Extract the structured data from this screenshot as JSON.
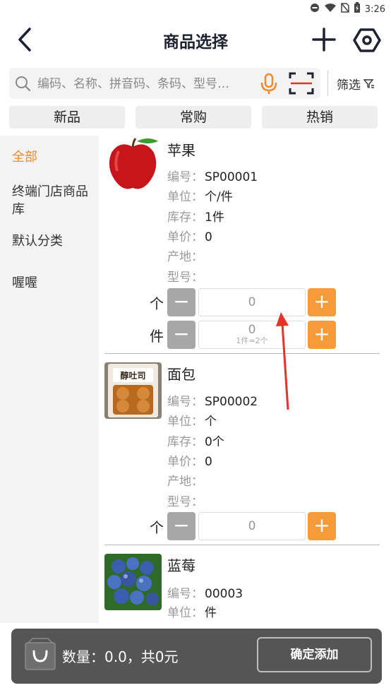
{
  "status_bar": {
    "time": "3:26"
  },
  "header": {
    "title": "商品选择"
  },
  "search": {
    "placeholder": "编码、名称、拼音码、条码、型号…",
    "filter_label": "筛选"
  },
  "tabs": [
    {
      "label": "新品"
    },
    {
      "label": "常购"
    },
    {
      "label": "热销"
    }
  ],
  "sidebar": {
    "items": [
      {
        "label": "全部",
        "active": true
      },
      {
        "label": "终端门店商品库"
      },
      {
        "label": "默认分类"
      },
      {
        "label": "喔喔"
      }
    ]
  },
  "products": [
    {
      "name": "苹果",
      "fields": [
        {
          "label": "编号：",
          "value": "SP00001"
        },
        {
          "label": "单位：",
          "value": "个/件"
        },
        {
          "label": "库存：",
          "value": "1件"
        },
        {
          "label": "单价：",
          "value": "0"
        },
        {
          "label": "产地：",
          "value": ""
        },
        {
          "label": "型号：",
          "value": ""
        }
      ],
      "qty": [
        {
          "unit": "个",
          "value": "0"
        },
        {
          "unit": "件",
          "value": "0",
          "hint": "1件=2个"
        }
      ]
    },
    {
      "name": "面包",
      "image_text": "醇吐司",
      "fields": [
        {
          "label": "编号：",
          "value": "SP00002"
        },
        {
          "label": "单位：",
          "value": "个"
        },
        {
          "label": "库存：",
          "value": "0个"
        },
        {
          "label": "单价：",
          "value": "0"
        },
        {
          "label": "产地：",
          "value": ""
        },
        {
          "label": "型号：",
          "value": ""
        }
      ],
      "qty": [
        {
          "unit": "个",
          "value": "0"
        }
      ]
    },
    {
      "name": "蓝莓",
      "fields": [
        {
          "label": "编号：",
          "value": "00003"
        },
        {
          "label": "单位：",
          "value": "件"
        }
      ]
    }
  ],
  "buttons": {
    "minus": "−",
    "plus": "+"
  },
  "bottom_bar": {
    "summary": "数量：0.0，共0元",
    "confirm_label": "确定添加"
  },
  "colors": {
    "accent": "#f08a2d",
    "plus_button": "#f59b3a",
    "minus_button": "#a7a7a7",
    "bottom_bar": "#555555"
  },
  "icons": [
    "back-arrow-icon",
    "plus-icon",
    "settings-hexagon-icon",
    "search-icon",
    "microphone-icon",
    "scan-icon",
    "filter-icon",
    "shopping-bag-icon"
  ]
}
